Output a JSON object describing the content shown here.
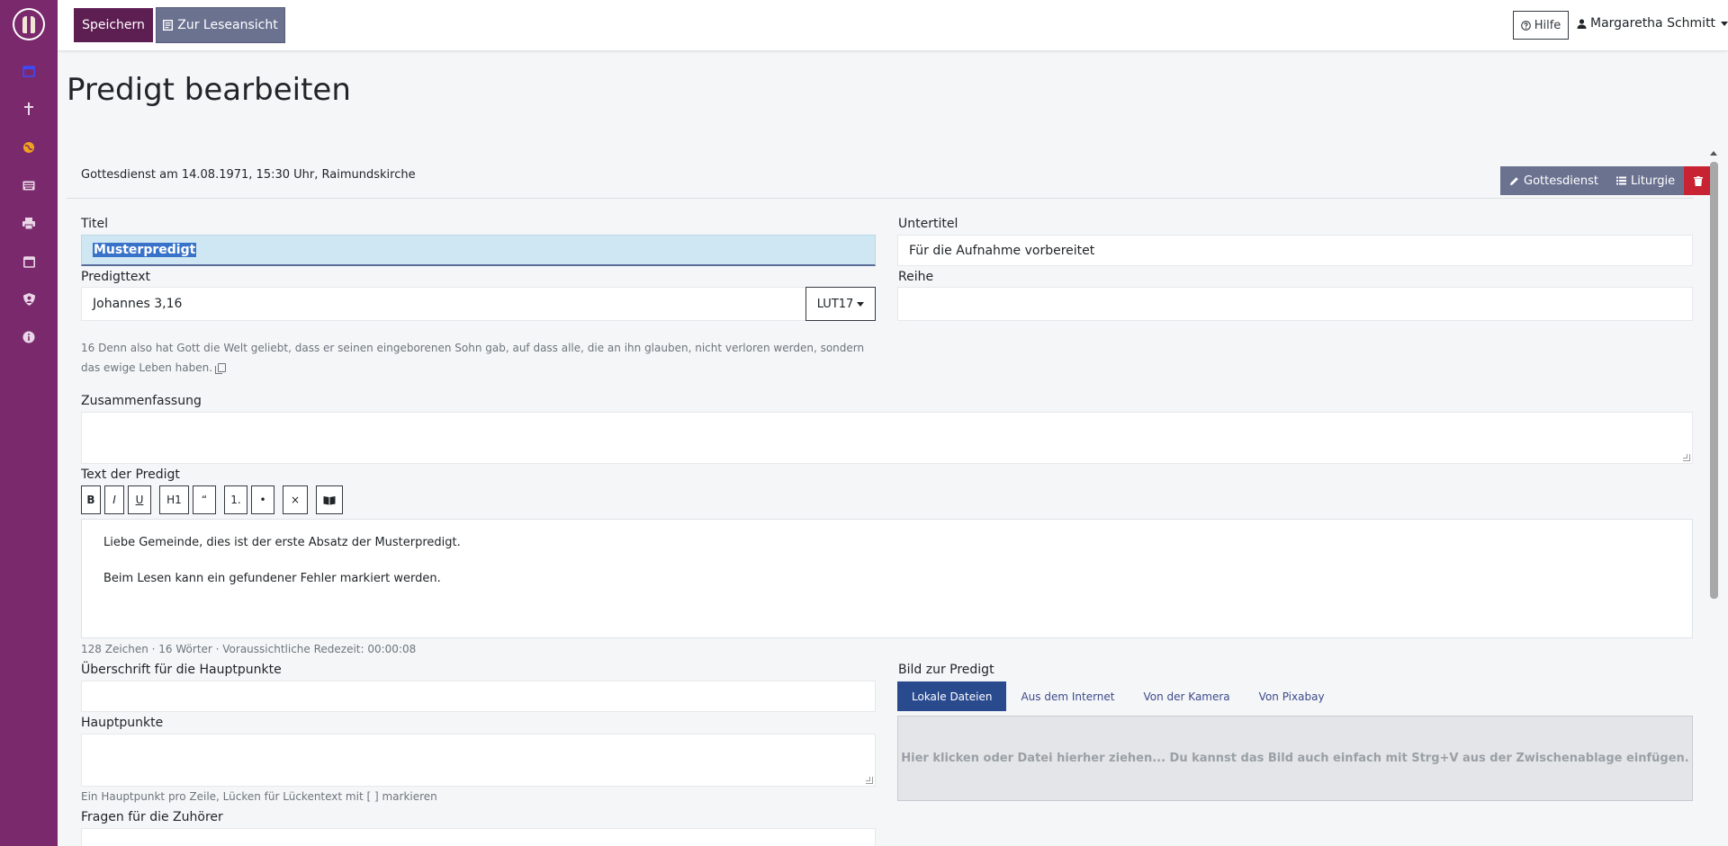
{
  "sidebar": {
    "logo": "church-logo",
    "icons": [
      "calendar-icon",
      "cross-icon",
      "globe-icon",
      "keyboard-icon",
      "printer-icon",
      "calendar-month-icon",
      "user-shield-icon",
      "info-icon"
    ]
  },
  "topbar": {
    "save_label": "Speichern",
    "read_view_label": "Zur Leseansicht",
    "help_label": "Hilfe",
    "user_name": "Margaretha Schmitt"
  },
  "page": {
    "title": "Predigt bearbeiten",
    "service_info": "Gottesdienst am 14.08.1971, 15:30 Uhr, Raimundskirche",
    "actions": {
      "service_label": "Gottesdienst",
      "liturgy_label": "Liturgie"
    }
  },
  "form": {
    "title_label": "Titel",
    "title_value": "Musterpredigt",
    "subtitle_label": "Untertitel",
    "subtitle_value": "Für die Aufnahme vorbereitet",
    "text_label": "Predigttext",
    "text_value": "Johannes 3,16",
    "translation": "LUT17",
    "series_label": "Reihe",
    "series_value": "",
    "bible_text": "16 Denn also hat Gott die Welt geliebt, dass er seinen eingeborenen Sohn gab, auf dass alle, die an ihn glauben, nicht verloren werden, sondern das ewige Leben haben.",
    "summary_label": "Zusammenfassung",
    "summary_value": "",
    "sermon_text_label": "Text der Predigt",
    "toolbar": {
      "bold": "B",
      "italic": "I",
      "underline": "U",
      "heading": "H1",
      "quote": "“",
      "ordered_list": "1.",
      "bullet_list": "•",
      "clear": "×"
    },
    "editor_paragraphs": [
      "Liebe Gemeinde, dies ist der erste Absatz der Musterpredigt.",
      "Beim Lesen kann ein gefundener Fehler markiert werden."
    ],
    "stats": "128 Zeichen · 16 Wörter · Voraussichtliche Redezeit: 00:00:08",
    "keypoints_heading_label": "Überschrift für die Hauptpunkte",
    "keypoints_heading_value": "",
    "keypoints_label": "Hauptpunkte",
    "keypoints_value": "",
    "keypoints_hint": "Ein Hauptpunkt pro Zeile, Lücken für Lückentext mit [ ] markieren",
    "questions_label": "Fragen für die Zuhörer",
    "image_label": "Bild zur Predigt",
    "image_tabs": [
      "Lokale Dateien",
      "Aus dem Internet",
      "Von der Kamera",
      "Von Pixabay"
    ],
    "dropzone_text": "Hier klicken oder Datei hierher ziehen... Du kannst das Bild auch einfach mit Strg+V aus der Zwischenablage einfügen."
  },
  "colors": {
    "sidebar": "#7a2a6c",
    "primary": "#5d1f52",
    "secondary": "#6b7290",
    "danger": "#c82333",
    "tab_active": "#2a4a8e"
  }
}
